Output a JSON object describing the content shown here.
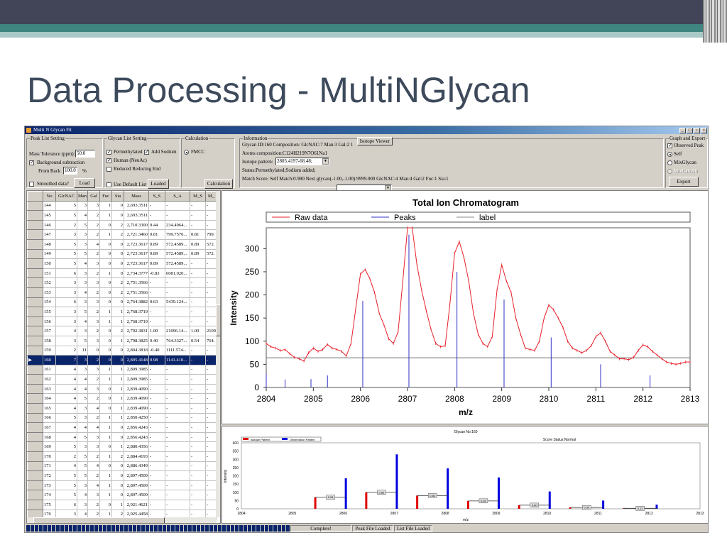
{
  "slide": {
    "title": "Data Processing - MultiNGlycan"
  },
  "window": {
    "title": "Multi N Glycan Fit",
    "controls": [
      "min",
      "restore",
      "close"
    ]
  },
  "peak_list": {
    "legend": "Peak List Setting",
    "mass_tol_label": "Mass Tolerance (ppm):",
    "mass_tol": "50.0",
    "bg_sub": "Background subtraction",
    "from_back_label": "From Back",
    "from_back": "100.0",
    "percent": "%",
    "smoothed": "Smoothed data?",
    "load": "Load"
  },
  "glycan_list": {
    "legend": "Glycan List Setting",
    "permethylated": "Permethylated",
    "add_sodium": "Add Sodium",
    "human": "Human (NeuAc)",
    "reduced": "Reduced Reducing End",
    "use_default": "Use Default List",
    "loaded": "Loaded"
  },
  "calculation": {
    "legend": "Calculation",
    "fmcc": "FMCC",
    "button": "Calculation"
  },
  "information": {
    "legend": "Information",
    "line1": "Glycan ID:160   Composition: GlcNAC:7   Man:3   Gal:2   1",
    "isotope_viewer": "Isotope Viewer",
    "atoms": "Atoms composition:C124H219N7O61Na1",
    "isotope_label": "Isotope pattern:",
    "isotope_value": "2805.4197-68.48;",
    "status": "Status:Permethylated;Sodium added;",
    "match": "Match Score: Self Match:0.980   Next glycan(-1.00,-1.00):9999.000   GlcNAC:4   Man:4   Gal:2   Fuc:1   Sia:1",
    "select_value": ""
  },
  "graph_export": {
    "legend": "Graph and Export",
    "observed": "Observed Peak",
    "self": "Self",
    "mix": "MixGlycan",
    "mix2": "MixCalcAll",
    "export": "Export"
  },
  "table": {
    "columns": [
      "No",
      "GlcNAC",
      "Man",
      "Gal",
      "Fuc",
      "Sia",
      "Mass",
      "S_S",
      "S_A",
      "M_S",
      "M_"
    ],
    "selected": "160",
    "rows": [
      [
        "144",
        "5",
        "3",
        "3",
        "1",
        "0",
        "2,693.3511",
        "-",
        "-",
        "-",
        "-"
      ],
      [
        "145",
        "5",
        "4",
        "2",
        "1",
        "0",
        "2,693.3511",
        "-",
        "-",
        "-",
        "-"
      ],
      [
        "146",
        "2",
        "5",
        "2",
        "0",
        "2",
        "2,710.3300",
        "0.44",
        "234.4964...",
        "-",
        "-"
      ],
      [
        "147",
        "3",
        "3",
        "2",
        "1",
        "2",
        "2,721.3460",
        "0.81",
        "799.7576...",
        "0.81",
        "799."
      ],
      [
        "148",
        "5",
        "3",
        "4",
        "0",
        "0",
        "2,723.3617",
        "0.89",
        "572.4589...",
        "0.89",
        "572."
      ],
      [
        "149",
        "5",
        "5",
        "2",
        "0",
        "0",
        "2,723.3617",
        "0.89",
        "572.4589...",
        "0.89",
        "572."
      ],
      [
        "150",
        "5",
        "4",
        "3",
        "0",
        "0",
        "2,723.3617",
        "0.89",
        "572.4589...",
        "-",
        "-"
      ],
      [
        "151",
        "6",
        "3",
        "2",
        "1",
        "0",
        "2,734.3777",
        "-0.83",
        "6081.020...",
        "-",
        "-"
      ],
      [
        "152",
        "3",
        "3",
        "3",
        "0",
        "2",
        "2,751.3566",
        "-",
        "-",
        "-",
        "-"
      ],
      [
        "153",
        "3",
        "4",
        "2",
        "0",
        "2",
        "2,751.3566",
        "-",
        "-",
        "-",
        "-"
      ],
      [
        "154",
        "6",
        "3",
        "3",
        "0",
        "0",
        "2,764.3882",
        "0.63",
        "5439.124...",
        "-",
        "-"
      ],
      [
        "155",
        "3",
        "5",
        "2",
        "1",
        "1",
        "2,768.3719",
        "-",
        "-",
        "-",
        "-"
      ],
      [
        "156",
        "3",
        "4",
        "3",
        "1",
        "1",
        "2,768.3719",
        "-",
        "-",
        "-",
        "-"
      ],
      [
        "157",
        "4",
        "3",
        "2",
        "0",
        "2",
        "2,792.3831",
        "1.00",
        "21096.14...",
        "1.00",
        "2109"
      ],
      [
        "158",
        "3",
        "5",
        "3",
        "0",
        "1",
        "2,798.3825",
        "0.40",
        "764.3327...",
        "0.54",
        "764."
      ],
      [
        "159",
        "2",
        "11",
        "0",
        "0",
        "0",
        "2,804.3818",
        "-0.40",
        "1111.574...",
        "-",
        "-"
      ],
      [
        "160",
        "7",
        "3",
        "2",
        "0",
        "0",
        "2,805.4148",
        "0.98",
        "1141.410...",
        "-",
        "-"
      ],
      [
        "161",
        "4",
        "3",
        "3",
        "1",
        "1",
        "2,809.3985",
        "-",
        "-",
        "-",
        "-"
      ],
      [
        "162",
        "4",
        "4",
        "2",
        "1",
        "1",
        "2,809.3985",
        "-",
        "-",
        "-",
        "-"
      ],
      [
        "163",
        "4",
        "4",
        "3",
        "0",
        "1",
        "2,839.4090",
        "-",
        "-",
        "-",
        "-"
      ],
      [
        "164",
        "4",
        "5",
        "2",
        "0",
        "1",
        "2,839.4090",
        "-",
        "-",
        "-",
        "-"
      ],
      [
        "165",
        "4",
        "3",
        "4",
        "0",
        "1",
        "2,839.4090",
        "-",
        "-",
        "-",
        "-"
      ],
      [
        "166",
        "5",
        "3",
        "2",
        "1",
        "1",
        "2,850.4250",
        "-",
        "-",
        "-",
        "-"
      ],
      [
        "167",
        "4",
        "4",
        "4",
        "1",
        "0",
        "2,856.4243",
        "-",
        "-",
        "-",
        "-"
      ],
      [
        "168",
        "4",
        "5",
        "3",
        "1",
        "0",
        "2,856.4243",
        "-",
        "-",
        "-",
        "-"
      ],
      [
        "169",
        "5",
        "3",
        "3",
        "0",
        "1",
        "2,880.4356",
        "-",
        "-",
        "-",
        "-"
      ],
      [
        "170",
        "2",
        "5",
        "2",
        "1",
        "2",
        "2,884.4193",
        "-",
        "-",
        "-",
        "-"
      ],
      [
        "171",
        "4",
        "5",
        "4",
        "0",
        "0",
        "2,886.4349",
        "-",
        "-",
        "-",
        "-"
      ],
      [
        "172",
        "5",
        "5",
        "2",
        "1",
        "0",
        "2,897.4509",
        "-",
        "-",
        "-",
        "-"
      ],
      [
        "173",
        "5",
        "3",
        "4",
        "1",
        "0",
        "2,897.4509",
        "-",
        "-",
        "-",
        "-"
      ],
      [
        "174",
        "5",
        "4",
        "3",
        "1",
        "0",
        "2,897.4509",
        "-",
        "-",
        "-",
        "-"
      ],
      [
        "175",
        "6",
        "3",
        "2",
        "0",
        "1",
        "2,921.4621",
        "-",
        "-",
        "-",
        "-"
      ],
      [
        "176",
        "3",
        "4",
        "2",
        "1",
        "2",
        "2,925.4458",
        "-",
        "-",
        "-",
        "-"
      ]
    ]
  },
  "status": {
    "progress": 1.0,
    "complete": "Complete!",
    "peak_file": "Peak File Loaded",
    "list_file": "List File Loaded"
  },
  "colors": {
    "raw": "#e8202a",
    "peaks": "#3030c8",
    "label": "#888888",
    "isotope": "#e00000",
    "observed": "#0000e0",
    "selection": "#0a246a"
  },
  "chart_data": [
    {
      "type": "line",
      "title": "Total Ion Chromatogram",
      "xlabel": "m/z",
      "ylabel": "Intensity",
      "xlim": [
        2804,
        2813
      ],
      "ylim": [
        0,
        345
      ],
      "xticks": [
        "2804",
        "2805",
        "2806",
        "2807",
        "2808",
        "2809",
        "2810",
        "2811",
        "2812",
        "2813"
      ],
      "yticks": [
        "0",
        "50",
        "100",
        "150",
        "200",
        "250",
        "300"
      ],
      "legend": [
        "Raw data",
        "Peaks",
        "label"
      ],
      "legend_position": "top",
      "raw_x_start": 2804,
      "raw_x_step": 0.1,
      "raw_y": [
        95,
        88,
        85,
        80,
        82,
        73,
        65,
        62,
        57,
        75,
        85,
        78,
        82,
        93,
        85,
        82,
        78,
        68,
        95,
        170,
        245,
        255,
        235,
        205,
        160,
        135,
        105,
        95,
        120,
        230,
        345,
        345,
        265,
        210,
        165,
        125,
        95,
        88,
        90,
        180,
        290,
        315,
        280,
        230,
        160,
        115,
        95,
        88,
        110,
        210,
        265,
        230,
        205,
        150,
        115,
        85,
        82,
        80,
        100,
        150,
        178,
        168,
        150,
        130,
        100,
        85,
        80,
        75,
        80,
        90,
        110,
        118,
        100,
        78,
        70,
        62,
        62,
        60,
        65,
        80,
        92,
        88,
        78,
        70,
        62,
        55,
        52,
        50,
        52,
        55,
        55
      ],
      "peaks": [
        [
          2804.0,
          30
        ],
        [
          2804.4,
          17
        ],
        [
          2804.95,
          18
        ],
        [
          2805.3,
          26
        ],
        [
          2806.05,
          187
        ],
        [
          2807.03,
          330
        ],
        [
          2808.05,
          250
        ],
        [
          2809.05,
          190
        ],
        [
          2810.05,
          108
        ],
        [
          2811.1,
          50
        ],
        [
          2812.15,
          26
        ]
      ],
      "label_level": 64
    },
    {
      "type": "bar",
      "title": "Glycan No:160",
      "subtitle": "Score Status:Normal",
      "xlabel": "m/z",
      "ylabel": "Intensity",
      "xlim": [
        2804,
        2813
      ],
      "ylim": [
        0,
        400
      ],
      "xticks": [
        "2804",
        "2805",
        "2806",
        "2807",
        "2808",
        "2809",
        "2810",
        "2811",
        "2812",
        "2813"
      ],
      "yticks": [
        "0",
        "50",
        "100",
        "150",
        "200",
        "250",
        "300",
        "350",
        "400"
      ],
      "legend": [
        "Isotope Pattern",
        "Observation Pattern"
      ],
      "legend_position": "top-left",
      "isotope": [
        [
          2805.45,
          70
        ],
        [
          2806.45,
          100
        ],
        [
          2807.45,
          80
        ],
        [
          2808.45,
          48
        ],
        [
          2809.45,
          22
        ],
        [
          2810.45,
          8
        ],
        [
          2811.5,
          3
        ]
      ],
      "observed": [
        [
          2806.05,
          185
        ],
        [
          2807.05,
          330
        ],
        [
          2808.05,
          245
        ],
        [
          2809.05,
          190
        ],
        [
          2810.05,
          105
        ],
        [
          2811.1,
          50
        ],
        [
          2812.15,
          25
        ]
      ],
      "labels": [
        "0.94",
        "0.82",
        "0.84",
        "0.82",
        "0.80",
        "0.30",
        "0.11"
      ]
    }
  ]
}
